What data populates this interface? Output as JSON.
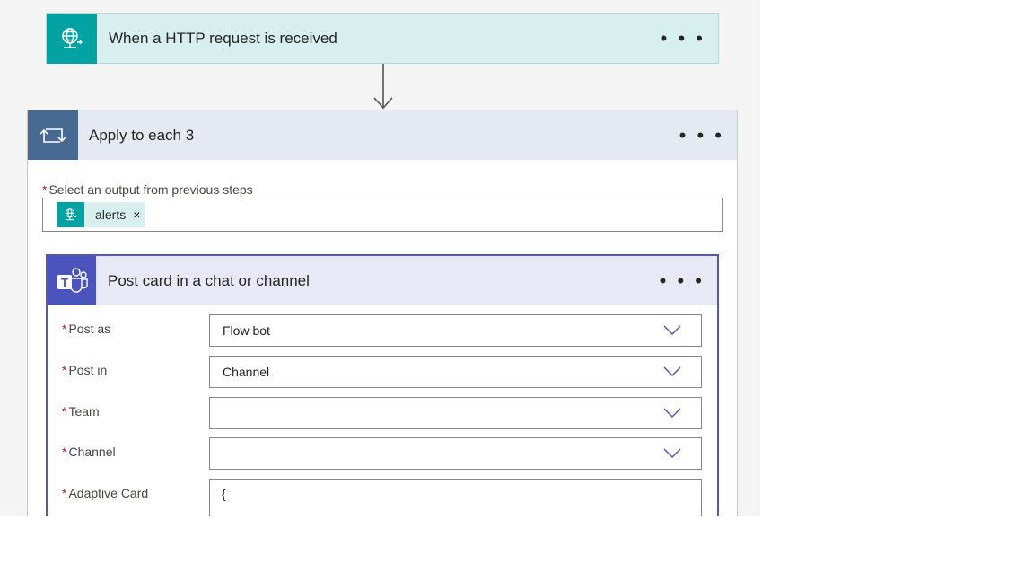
{
  "trigger": {
    "title": "When a HTTP request is received",
    "icon": "globe-arrow-icon",
    "color": "#00a3a1"
  },
  "loop": {
    "title": "Apply to each 3",
    "icon": "loop-icon",
    "color": "#486991",
    "output_label": "Select an output from previous steps",
    "token": {
      "label": "alerts",
      "remove": "×"
    }
  },
  "action": {
    "title": "Post card in a chat or channel",
    "icon": "teams-icon",
    "color": "#4b53bc",
    "fields": {
      "post_as": {
        "label": "Post as",
        "value": "Flow bot"
      },
      "post_in": {
        "label": "Post in",
        "value": "Channel"
      },
      "team": {
        "label": "Team",
        "value": ""
      },
      "channel": {
        "label": "Channel",
        "value": ""
      },
      "card": {
        "label": "Adaptive Card",
        "value": "{"
      }
    }
  },
  "menu": {
    "dots": "• • •"
  },
  "required_marker": "*"
}
